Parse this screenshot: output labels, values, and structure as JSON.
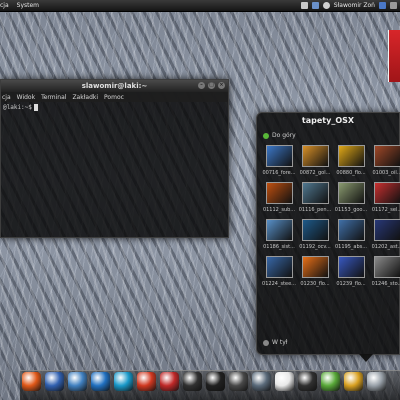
{
  "top_panel": {
    "menu_left": "cja",
    "menu_system": "System",
    "user_label": "Sławomir Zoń"
  },
  "terminal": {
    "title": "slawomir@laki:~",
    "menu": [
      "cja",
      "Widok",
      "Terminal",
      "Zakładki",
      "Pomoc"
    ],
    "prompt": "@laki:~$"
  },
  "stack": {
    "title": "tapety_OSX",
    "up_label": "Do góry",
    "footer_label": "W tył",
    "items": [
      {
        "caption": "00716_fore...",
        "color": "#3c78c8"
      },
      {
        "caption": "00872_gol...",
        "color": "#d89028"
      },
      {
        "caption": "00880_flo...",
        "color": "#e0a818"
      },
      {
        "caption": "01003_oil...",
        "color": "#a04828"
      },
      {
        "caption": "01112_sub...",
        "color": "#c05010"
      },
      {
        "caption": "01116_pen...",
        "color": "#507890"
      },
      {
        "caption": "01153_goo...",
        "color": "#8a9a70"
      },
      {
        "caption": "01172_sel...",
        "color": "#c83030"
      },
      {
        "caption": "01186_sist...",
        "color": "#5890c8"
      },
      {
        "caption": "01192_ocv...",
        "color": "#1e5a8a"
      },
      {
        "caption": "01195_abs...",
        "color": "#4070a8"
      },
      {
        "caption": "01202_ast...",
        "color": "#283878"
      },
      {
        "caption": "01224_stee...",
        "color": "#3868a8"
      },
      {
        "caption": "01230_flo...",
        "color": "#e87018"
      },
      {
        "caption": "01239_flo...",
        "color": "#3858c0"
      },
      {
        "caption": "01246_sto...",
        "color": "#8a8a8a"
      }
    ]
  },
  "dock": {
    "icons": [
      {
        "name": "firefox-icon",
        "color": "#e05818"
      },
      {
        "name": "thunderbird-icon",
        "color": "#3060b0"
      },
      {
        "name": "mail-icon",
        "color": "#4080c0"
      },
      {
        "name": "media-player-icon",
        "color": "#2070c0"
      },
      {
        "name": "music-icon",
        "color": "#1898c8"
      },
      {
        "name": "tomato-icon",
        "color": "#d03820"
      },
      {
        "name": "tools-icon",
        "color": "#c02828"
      },
      {
        "name": "grid-icon",
        "color": "#303030"
      },
      {
        "name": "monitor-icon",
        "color": "#202020"
      },
      {
        "name": "book-icon",
        "color": "#484848"
      },
      {
        "name": "cloud-icon",
        "color": "#5a6a7a"
      },
      {
        "name": "calendar-icon",
        "color": "#e8e8e8"
      },
      {
        "name": "camera-icon",
        "color": "#303030"
      },
      {
        "name": "chart-icon",
        "color": "#58a838"
      },
      {
        "name": "gnome-icon",
        "color": "#d8a020"
      },
      {
        "name": "folder-icon",
        "color": "#98a0a8"
      }
    ]
  }
}
